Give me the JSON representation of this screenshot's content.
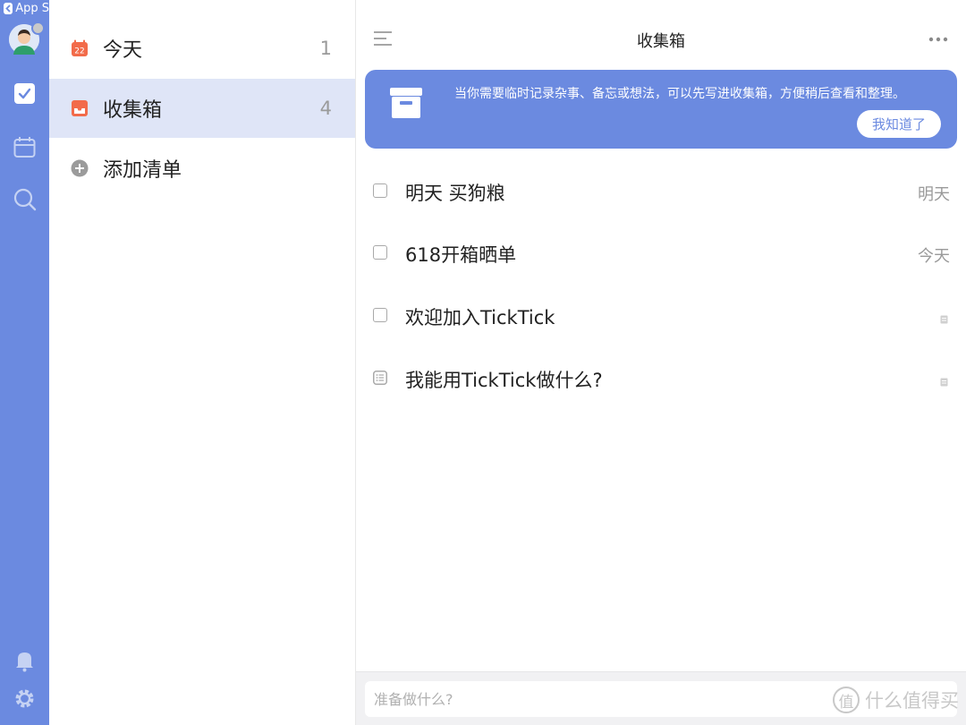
{
  "rail": {
    "back_label": "App S",
    "icons": [
      "checkbox-icon",
      "calendar-icon",
      "search-icon",
      "bell-icon",
      "gear-icon"
    ]
  },
  "sidebar": {
    "items": [
      {
        "label": "今天",
        "count": "1",
        "icon": "calendar-22-icon",
        "date": "22"
      },
      {
        "label": "收集箱",
        "count": "4",
        "icon": "inbox-icon"
      },
      {
        "label": "添加清单",
        "icon": "add-circle-icon"
      }
    ]
  },
  "main": {
    "title": "收集箱",
    "banner": {
      "text": "当你需要临时记录杂事、备忘或想法，可以先写进收集箱，方便稍后查看和整理。",
      "button_label": "我知道了"
    },
    "tasks": [
      {
        "title": "明天 买狗粮",
        "date": "明天",
        "kind": "checkbox"
      },
      {
        "title": "618开箱晒单",
        "date": "今天",
        "kind": "checkbox"
      },
      {
        "title": "欢迎加入TickTick",
        "date": "",
        "kind": "checkbox",
        "has_note": true
      },
      {
        "title": "我能用TickTick做什么?",
        "date": "",
        "kind": "note",
        "has_note": true
      }
    ],
    "add_placeholder": "准备做什么?"
  },
  "watermark": {
    "seal": "值",
    "text": "什么值得买"
  },
  "colors": {
    "accent": "#6b8ae0",
    "active_row": "#dfe5f7",
    "today_icon": "#f26b4a"
  }
}
